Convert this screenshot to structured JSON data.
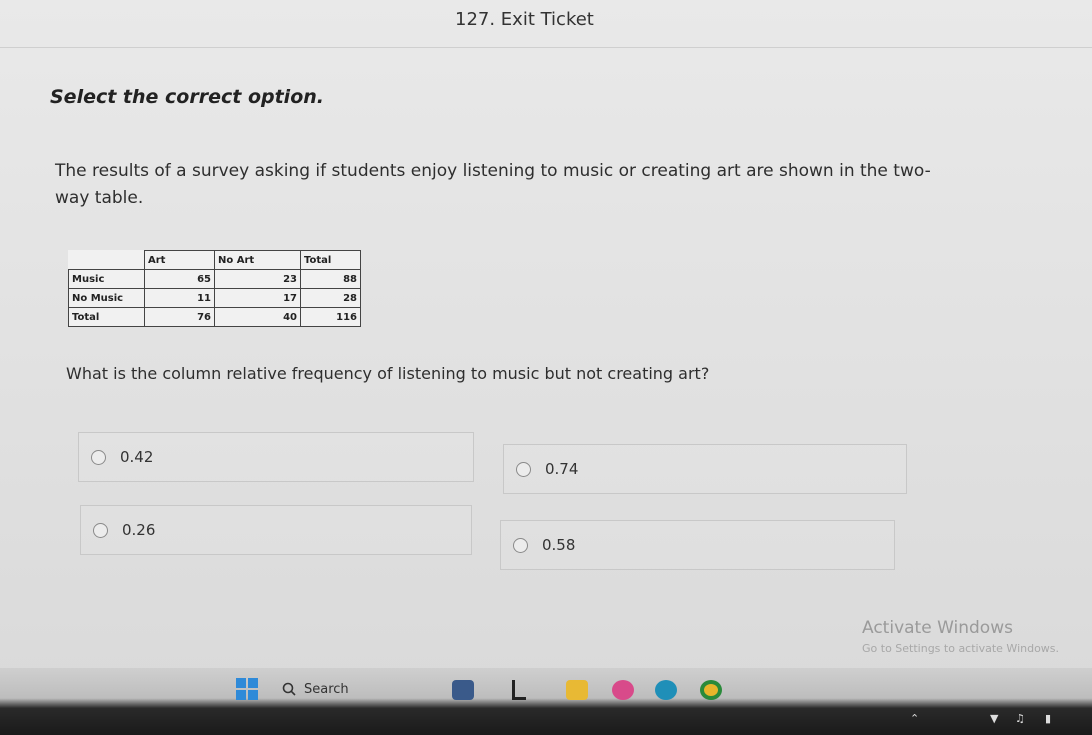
{
  "header": {
    "title": "127. Exit Ticket"
  },
  "instruction": "Select the correct option.",
  "question": "The results of a survey asking if students enjoy listening to music or creating art are shown in the two-way table.",
  "table": {
    "columns": [
      "",
      "Art",
      "No Art",
      "Total"
    ],
    "rows": [
      {
        "label": "Music",
        "values": [
          "65",
          "23",
          "88"
        ]
      },
      {
        "label": "No Music",
        "values": [
          "11",
          "17",
          "28"
        ]
      },
      {
        "label": "Total",
        "values": [
          "76",
          "40",
          "116"
        ]
      }
    ]
  },
  "prompt": "What is the column relative frequency of listening to music but not creating art?",
  "options": [
    {
      "label": "0.42"
    },
    {
      "label": "0.74"
    },
    {
      "label": "0.26"
    },
    {
      "label": "0.58"
    }
  ],
  "watermark": {
    "title": "Activate Windows",
    "subtitle": "Go to Settings to activate Windows."
  },
  "taskbar": {
    "search_label": "Search"
  },
  "colors": {
    "accent": "#2f8ad8",
    "background": "#e4e4e4"
  }
}
